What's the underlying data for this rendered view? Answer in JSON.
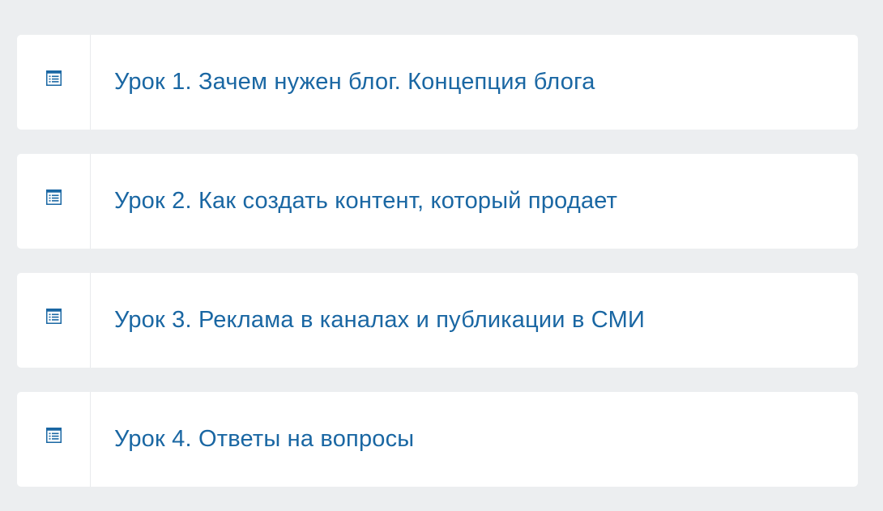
{
  "lessons": [
    {
      "title": "Урок 1. Зачем нужен блог. Концепция блога",
      "icon": "document-list-icon"
    },
    {
      "title": "Урок 2. Как создать контент, который продает",
      "icon": "document-list-icon"
    },
    {
      "title": "Урок 3. Реклама в каналах и публикации в СМИ",
      "icon": "document-list-icon"
    },
    {
      "title": "Урок 4. Ответы на вопросы",
      "icon": "document-list-icon"
    }
  ],
  "colors": {
    "background": "#eceef0",
    "card": "#ffffff",
    "accent": "#1a67a3"
  }
}
